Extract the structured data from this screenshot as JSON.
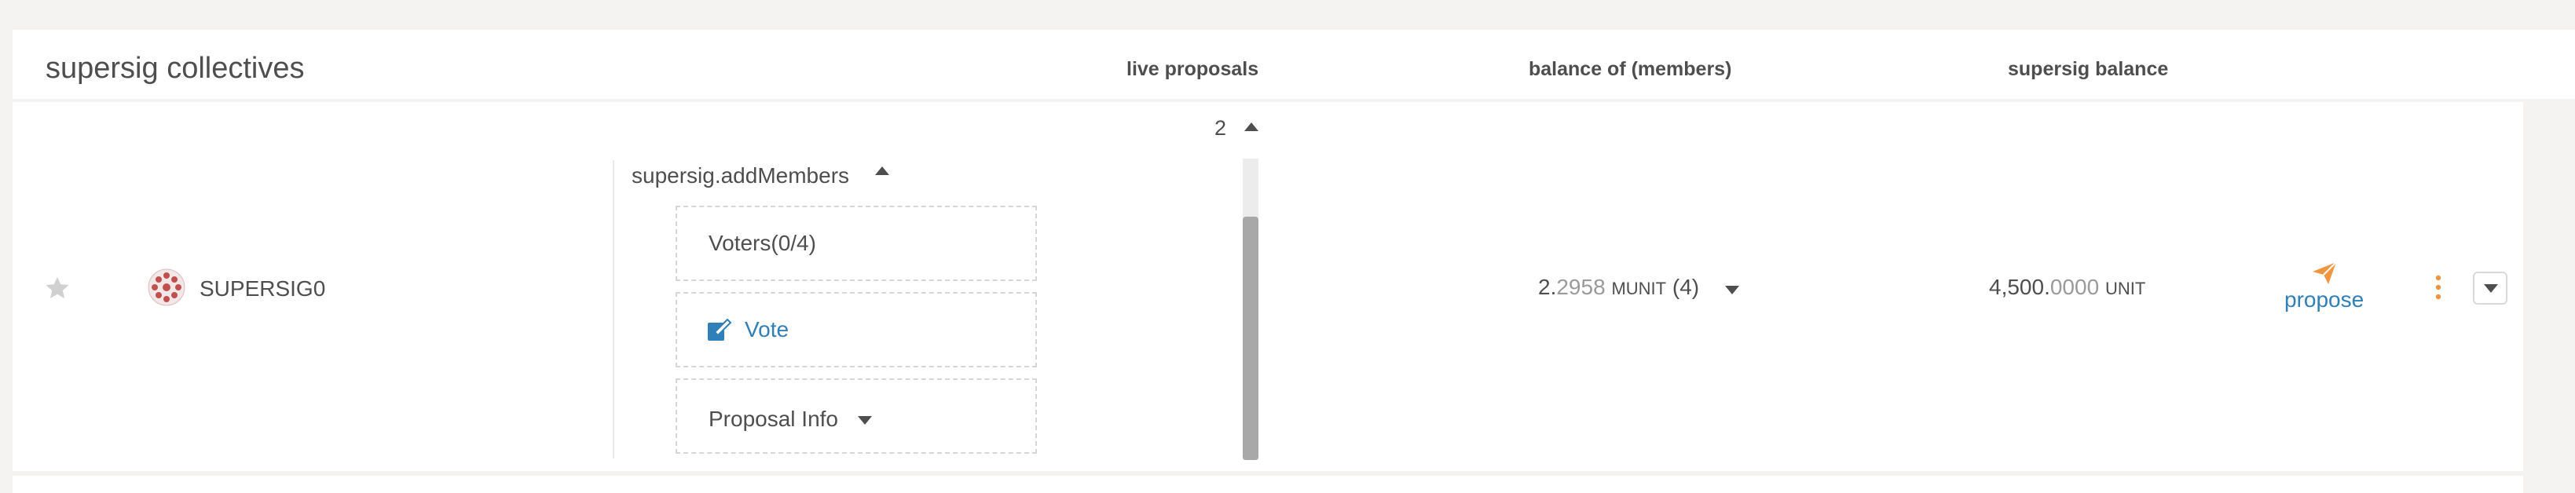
{
  "header": {
    "title": "supersig collectives",
    "columns": {
      "live_proposals": "live proposals",
      "balance_members": "balance of (members)",
      "supersig_balance": "supersig balance"
    }
  },
  "row": {
    "account_name": "SUPERSIG0",
    "proposals_count": "2",
    "proposal": {
      "method": "supersig.addMembers",
      "voters_label": "Voters(0/4)",
      "vote_label": "Vote",
      "info_label": "Proposal Info"
    },
    "members_balance": {
      "integer": "2.",
      "decimals": "2958",
      "unit": "MUNIT",
      "members": "(4)"
    },
    "supersig_balance": {
      "integer": "4,500.",
      "decimals": "0000",
      "unit": "UNIT"
    },
    "propose_label": "propose"
  },
  "colors": {
    "accent_link": "#2f7fb8",
    "propose_icon": "#f0953f",
    "text": "#4e4e4e",
    "identicon_red": "#c0504d"
  },
  "icons": [
    "star-icon",
    "identicon",
    "caret-up-icon",
    "vote-edit-icon",
    "caret-down-icon",
    "paper-plane-icon",
    "more-vertical-icon"
  ]
}
